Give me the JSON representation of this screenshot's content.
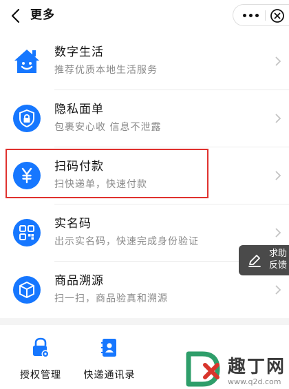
{
  "header": {
    "title": "更多"
  },
  "items": [
    {
      "name": "数字生活",
      "desc": "推荐优质本地生活服务",
      "icon": "house-smile-icon"
    },
    {
      "name": "隐私面单",
      "desc": "包裹安心收 信息不泄露",
      "icon": "shield-lock-icon"
    },
    {
      "name": "扫码付款",
      "desc": "扫快递单，快速付款",
      "icon": "yen-icon"
    },
    {
      "name": "实名码",
      "desc": "出示实名码，快速完成身份验证",
      "icon": "qr-code-icon"
    },
    {
      "name": "商品溯源",
      "desc": "扫一扫，商品验真和溯源",
      "icon": "box-icon"
    }
  ],
  "float": {
    "line1": "求助",
    "line2": "反馈"
  },
  "tools": [
    {
      "label": "授权管理",
      "icon": "lock-gear-icon"
    },
    {
      "label": "快递通讯录",
      "icon": "contact-book-icon"
    }
  ],
  "watermark": {
    "text": "趣丁网",
    "url": "www.q2d.com"
  },
  "colors": {
    "accent": "#1677ff",
    "highlight": "#e0322e"
  }
}
